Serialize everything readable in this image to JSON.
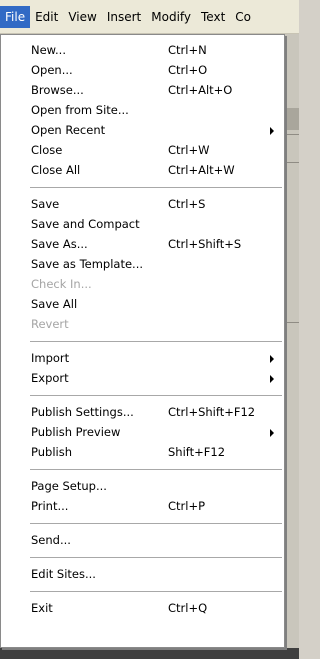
{
  "menubar": {
    "items": [
      "File",
      "Edit",
      "View",
      "Insert",
      "Modify",
      "Text",
      "Co"
    ]
  },
  "file_menu": {
    "new": {
      "label": "New...",
      "shortcut": "Ctrl+N"
    },
    "open": {
      "label": "Open...",
      "shortcut": "Ctrl+O"
    },
    "browse": {
      "label": "Browse...",
      "shortcut": "Ctrl+Alt+O"
    },
    "open_from_site": {
      "label": "Open from Site..."
    },
    "open_recent": {
      "label": "Open Recent"
    },
    "close": {
      "label": "Close",
      "shortcut": "Ctrl+W"
    },
    "close_all": {
      "label": "Close All",
      "shortcut": "Ctrl+Alt+W"
    },
    "save": {
      "label": "Save",
      "shortcut": "Ctrl+S"
    },
    "save_and_compact": {
      "label": "Save and Compact"
    },
    "save_as": {
      "label": "Save As...",
      "shortcut": "Ctrl+Shift+S"
    },
    "save_as_template": {
      "label": "Save as Template..."
    },
    "check_in": {
      "label": "Check In..."
    },
    "save_all": {
      "label": "Save All"
    },
    "revert": {
      "label": "Revert"
    },
    "import": {
      "label": "Import"
    },
    "export": {
      "label": "Export"
    },
    "publish_settings": {
      "label": "Publish Settings...",
      "shortcut": "Ctrl+Shift+F12"
    },
    "publish_preview": {
      "label": "Publish Preview"
    },
    "publish": {
      "label": "Publish",
      "shortcut": "Shift+F12"
    },
    "page_setup": {
      "label": "Page Setup..."
    },
    "print": {
      "label": "Print...",
      "shortcut": "Ctrl+P"
    },
    "send": {
      "label": "Send..."
    },
    "edit_sites": {
      "label": "Edit Sites..."
    },
    "exit": {
      "label": "Exit",
      "shortcut": "Ctrl+Q"
    }
  }
}
